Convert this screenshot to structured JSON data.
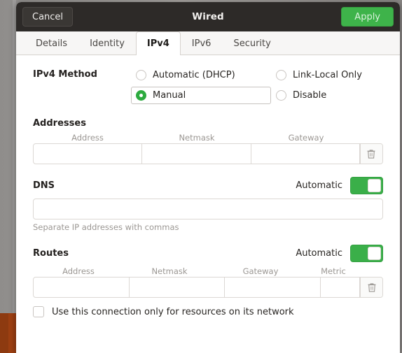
{
  "header": {
    "title": "Wired",
    "cancel_label": "Cancel",
    "apply_label": "Apply",
    "apply_color": "#3eb34a"
  },
  "tabs": [
    {
      "label": "Details",
      "active": false
    },
    {
      "label": "Identity",
      "active": false
    },
    {
      "label": "IPv4",
      "active": true
    },
    {
      "label": "IPv6",
      "active": false
    },
    {
      "label": "Security",
      "active": false
    }
  ],
  "ipv4_method": {
    "label": "IPv4 Method",
    "options": [
      {
        "label": "Automatic (DHCP)",
        "selected": false,
        "focused": false
      },
      {
        "label": "Link-Local Only",
        "selected": false,
        "focused": false
      },
      {
        "label": "Manual",
        "selected": true,
        "focused": true
      },
      {
        "label": "Disable",
        "selected": false,
        "focused": false
      }
    ],
    "selected_value": "Manual",
    "selected_color": "#2dab3f"
  },
  "addresses": {
    "heading": "Addresses",
    "columns": [
      "Address",
      "Netmask",
      "Gateway"
    ],
    "rows": [
      {
        "Address": "",
        "Netmask": "",
        "Gateway": ""
      }
    ],
    "delete_icon": "trash-icon"
  },
  "dns": {
    "heading": "DNS",
    "toggle_label": "Automatic",
    "toggle_on": true,
    "toggle_color": "#3aaf49",
    "value": "",
    "placeholder": "",
    "hint": "Separate IP addresses with commas"
  },
  "routes": {
    "heading": "Routes",
    "toggle_label": "Automatic",
    "toggle_on": true,
    "toggle_color": "#3aaf49",
    "columns": [
      "Address",
      "Netmask",
      "Gateway",
      "Metric"
    ],
    "rows": [
      {
        "Address": "",
        "Netmask": "",
        "Gateway": "",
        "Metric": ""
      }
    ],
    "delete_icon": "trash-icon"
  },
  "restrict": {
    "label": "Use this connection only for resources on its network",
    "checked": false
  }
}
